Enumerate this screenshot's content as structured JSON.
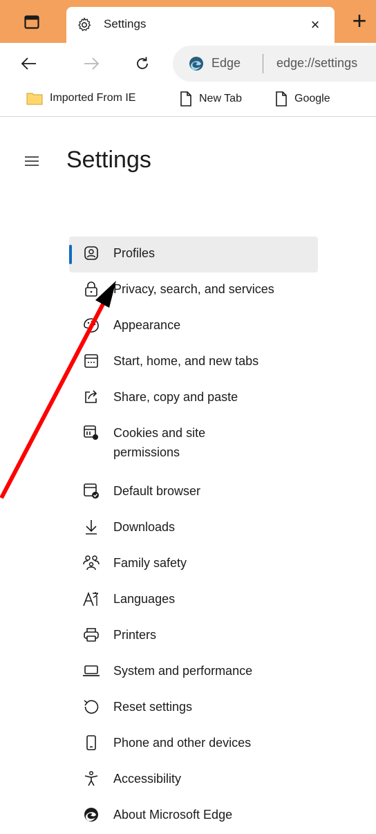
{
  "browser": {
    "tab": {
      "title": "Settings",
      "close_glyph": "×"
    },
    "new_tab_glyph": "+",
    "address": {
      "brand": "Edge",
      "url": "edge://settings"
    },
    "favorites": [
      {
        "label": "Imported From IE",
        "icon": "folder-icon"
      },
      {
        "label": "New Tab",
        "icon": "page-icon"
      },
      {
        "label": "Google",
        "icon": "page-icon"
      }
    ]
  },
  "settings": {
    "title": "Settings",
    "menu": [
      {
        "label": "Profiles",
        "icon": "profile-icon",
        "selected": true
      },
      {
        "label": "Privacy, search, and services",
        "icon": "lock-icon"
      },
      {
        "label": "Appearance",
        "icon": "palette-icon"
      },
      {
        "label": "Start, home, and new tabs",
        "icon": "start-tabs-icon"
      },
      {
        "label": "Share, copy and paste",
        "icon": "share-icon"
      },
      {
        "label": "Cookies and site permissions",
        "icon": "cookies-icon"
      },
      {
        "label": "Default browser",
        "icon": "default-browser-icon"
      },
      {
        "label": "Downloads",
        "icon": "download-icon"
      },
      {
        "label": "Family safety",
        "icon": "family-icon"
      },
      {
        "label": "Languages",
        "icon": "language-icon"
      },
      {
        "label": "Printers",
        "icon": "printer-icon"
      },
      {
        "label": "System and performance",
        "icon": "laptop-icon"
      },
      {
        "label": "Reset settings",
        "icon": "reset-icon"
      },
      {
        "label": "Phone and other devices",
        "icon": "phone-icon"
      },
      {
        "label": "Accessibility",
        "icon": "accessibility-icon"
      },
      {
        "label": "About Microsoft Edge",
        "icon": "edge-logo-icon"
      }
    ]
  },
  "colors": {
    "tabstrip": "#f3a15c",
    "accent": "#0f6cbd",
    "annotation_arrow": "#ff0000"
  }
}
